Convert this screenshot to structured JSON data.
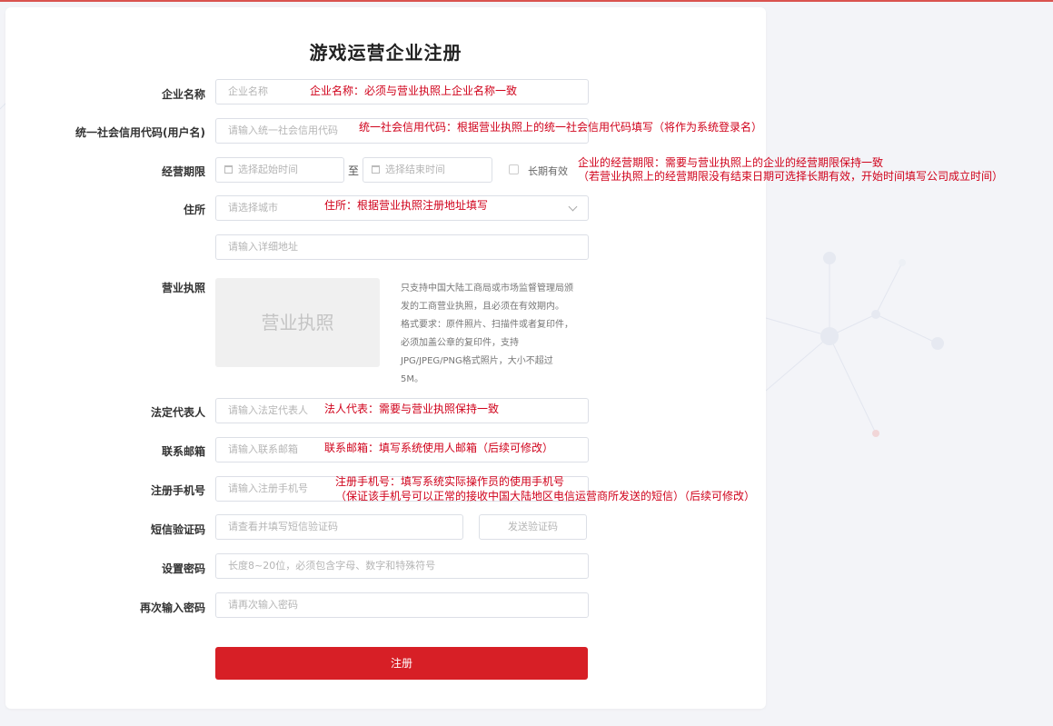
{
  "title": "游戏运营企业注册",
  "fields": {
    "company_name": {
      "label": "企业名称",
      "placeholder": "企业名称",
      "note": "企业名称：必须与营业执照上企业名称一致"
    },
    "credit_code": {
      "label": "统一社会信用代码(用户名)",
      "placeholder": "请输入统一社会信用代码",
      "note": "统一社会信用代码：根据营业执照上的统一社会信用代码填写（将作为系统登录名）"
    },
    "period": {
      "label": "经营期限",
      "start_placeholder": "选择起始时间",
      "to": "至",
      "end_placeholder": "选择结束时间",
      "long_term": "长期有效",
      "note_line1": "企业的经营期限：需要与营业执照上的企业的经营期限保持一致",
      "note_line2": "（若营业执照上的经营期限没有结束日期可选择长期有效，开始时间填写公司成立时间）"
    },
    "address": {
      "label": "住所",
      "city_placeholder": "请选择城市",
      "note": "住所：根据营业执照注册地址填写",
      "detail_placeholder": "请输入详细地址"
    },
    "license": {
      "label": "营业执照",
      "upload_text": "营业执照",
      "hint_lines": [
        "只支持中国大陆工商局或市场监督管理局颁",
        "发的工商营业执照，且必须在有效期内。",
        "格式要求：原件照片、扫描件或者复印件，",
        "必须加盖公章的复印件，支持",
        "JPG/JPEG/PNG格式照片，大小不超过",
        "5M。"
      ]
    },
    "legal_rep": {
      "label": "法定代表人",
      "placeholder": "请输入法定代表人",
      "note": "法人代表：需要与营业执照保持一致"
    },
    "email": {
      "label": "联系邮箱",
      "placeholder": "请输入联系邮箱",
      "note": "联系邮箱：填写系统使用人邮箱（后续可修改）"
    },
    "phone": {
      "label": "注册手机号",
      "placeholder": "请输入注册手机号",
      "note_line1": "注册手机号：填写系统实际操作员的使用手机号",
      "note_line2": "（保证该手机号可以正常的接收中国大陆地区电信运营商所发送的短信）（后续可修改）"
    },
    "sms_code": {
      "label": "短信验证码",
      "placeholder": "请查看并填写短信验证码",
      "send_button": "发送验证码"
    },
    "password": {
      "label": "设置密码",
      "placeholder": "长度8~20位，必须包含字母、数字和特殊符号"
    },
    "password_confirm": {
      "label": "再次输入密码",
      "placeholder": "请再次输入密码"
    }
  },
  "submit_label": "注册",
  "colors": {
    "accent": "#d71f26",
    "annotation": "#d0021b"
  }
}
